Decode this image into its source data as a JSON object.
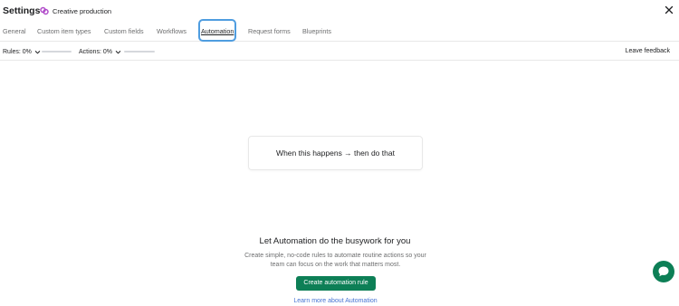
{
  "header": {
    "title": "Settings",
    "project_name": "Creative production",
    "project_icon": "project-icon",
    "close_icon": "close-icon"
  },
  "tabs": [
    {
      "label": "General",
      "active": false
    },
    {
      "label": "Custom item types",
      "active": false
    },
    {
      "label": "Custom fields",
      "active": false
    },
    {
      "label": "Workflows",
      "active": false
    },
    {
      "label": "Automation",
      "active": true
    },
    {
      "label": "Request forms",
      "active": false
    },
    {
      "label": "Blueprints",
      "active": false
    }
  ],
  "toolbar": {
    "rules_label": "Rules: 0%",
    "rules_value": 0,
    "actions_label": "Actions: 0%",
    "actions_value": 0,
    "leave_feedback": "Leave feedback"
  },
  "example_card": {
    "text": "When this happens → then do that"
  },
  "empty_state": {
    "heading": "Let Automation do the busywork for you",
    "description": "Create simple, no-code rules to automate routine actions so your team can focus on the work that matters most.",
    "create_button": "Create automation rule",
    "learn_link": "Learn more about Automation"
  },
  "colors": {
    "accent_green": "#0d7f56",
    "project_icon": "#b04ac9",
    "link_blue": "#4573d2",
    "focus_ring": "#4f9de0"
  }
}
